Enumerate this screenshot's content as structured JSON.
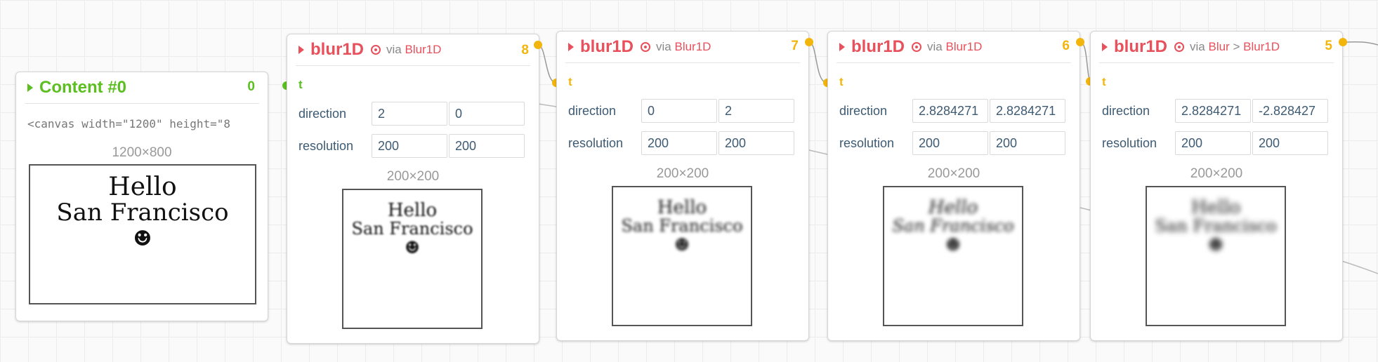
{
  "content_node": {
    "title": "Content #0",
    "count": "0",
    "code": "<canvas width=\"1200\" height=\"8",
    "size": "1200×800",
    "preview_line1": "Hello",
    "preview_line2": "San Francisco",
    "preview_glyph": "☻"
  },
  "nodes": [
    {
      "title": "blur1D",
      "via_prefix": "via",
      "via_parts": [
        "Blur1D"
      ],
      "count": "8",
      "port_label": "t",
      "direction_label": "direction",
      "direction": [
        "2",
        "0"
      ],
      "resolution_label": "resolution",
      "resolution": [
        "200",
        "200"
      ],
      "size": "200×200",
      "preview_line1": "Hello",
      "preview_line2": "San Francisco",
      "preview_glyph": "☻"
    },
    {
      "title": "blur1D",
      "via_prefix": "via",
      "via_parts": [
        "Blur1D"
      ],
      "count": "7",
      "port_label": "t",
      "direction_label": "direction",
      "direction": [
        "0",
        "2"
      ],
      "resolution_label": "resolution",
      "resolution": [
        "200",
        "200"
      ],
      "size": "200×200",
      "preview_line1": "Hello",
      "preview_line2": "San Francisco",
      "preview_glyph": "☻"
    },
    {
      "title": "blur1D",
      "via_prefix": "via",
      "via_parts": [
        "Blur1D"
      ],
      "count": "6",
      "port_label": "t",
      "direction_label": "direction",
      "direction": [
        "2.8284271",
        "2.8284271"
      ],
      "resolution_label": "resolution",
      "resolution": [
        "200",
        "200"
      ],
      "size": "200×200",
      "preview_line1": "Hello",
      "preview_line2": "San Francisco",
      "preview_glyph": "☻"
    },
    {
      "title": "blur1D",
      "via_prefix": "via",
      "via_parts": [
        "Blur",
        ">",
        "Blur1D"
      ],
      "count": "5",
      "port_label": "t",
      "direction_label": "direction",
      "direction": [
        "2.8284271",
        "-2.828427"
      ],
      "resolution_label": "resolution",
      "resolution": [
        "200",
        "200"
      ],
      "size": "200×200",
      "preview_line1": "Hello",
      "preview_line2": "San Francisco",
      "preview_glyph": "☻"
    }
  ],
  "colors": {
    "accent_red": "#e8505b",
    "port_yellow": "#f2b50c",
    "content_green": "#5bbf21"
  }
}
